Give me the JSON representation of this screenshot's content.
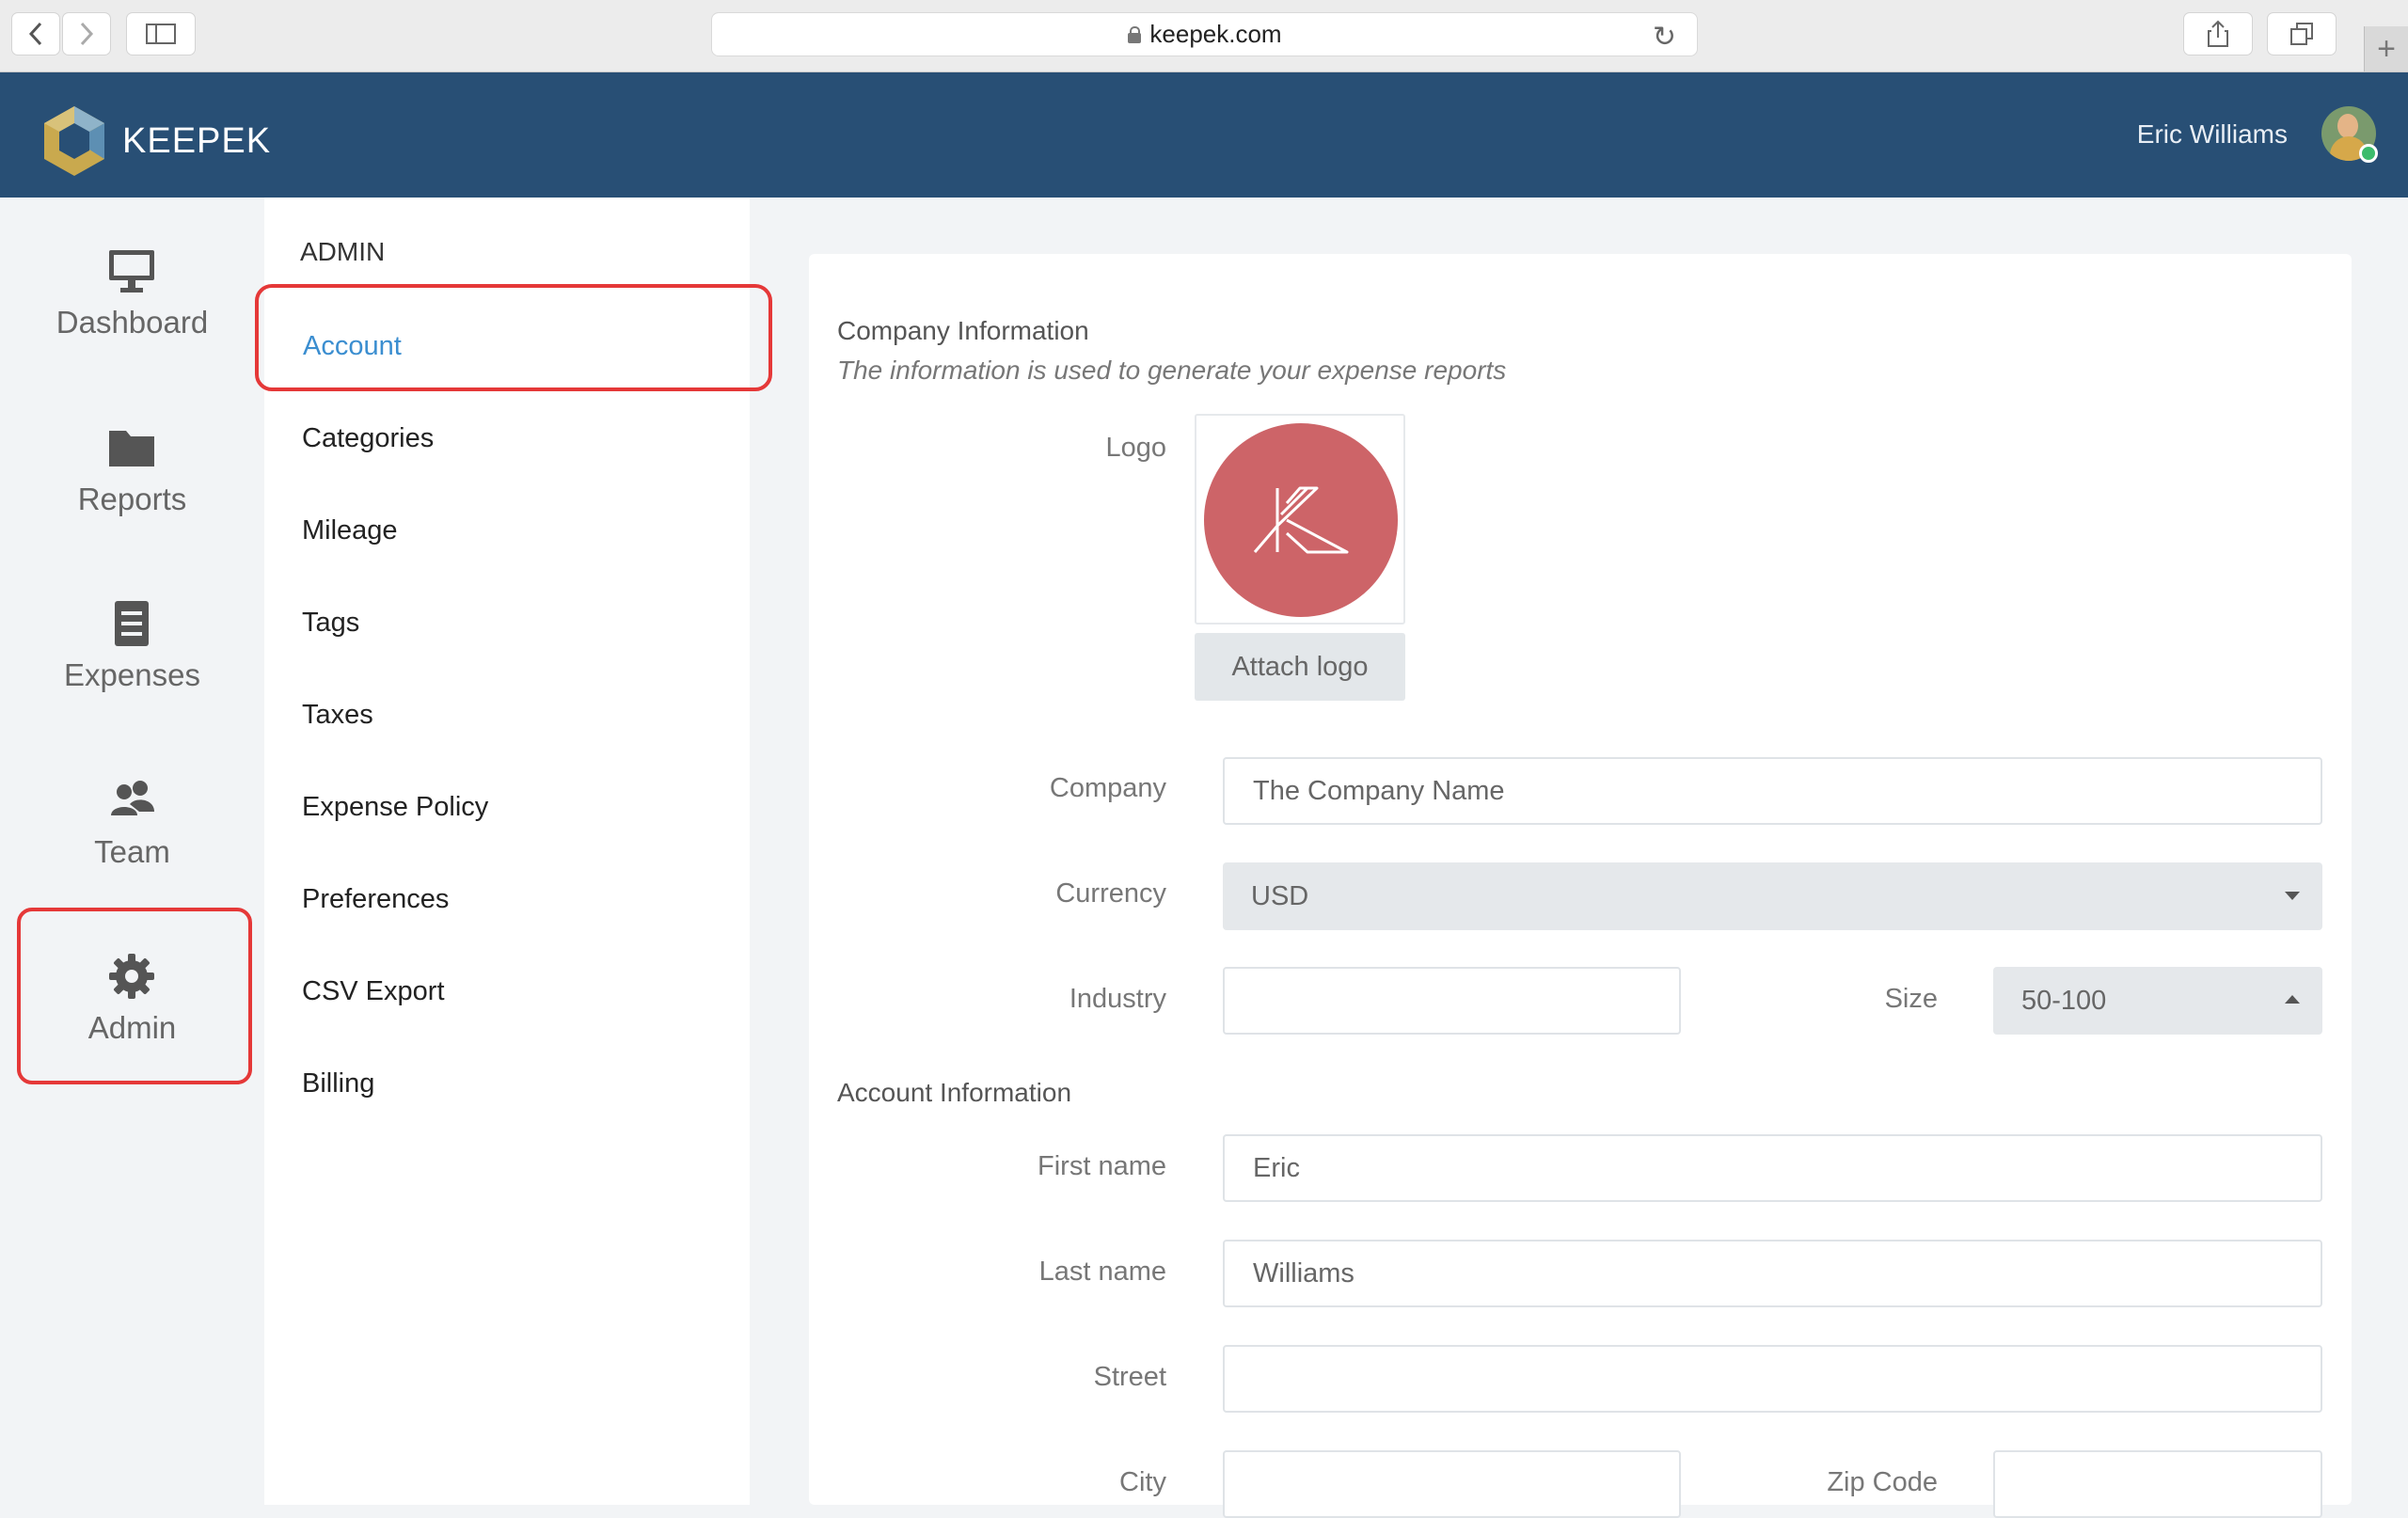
{
  "browser": {
    "url": "keepek.com"
  },
  "header": {
    "brand": "KEEPEK",
    "user_name": "Eric Williams"
  },
  "left_nav": {
    "items": [
      {
        "label": "Dashboard",
        "icon": "monitor-icon"
      },
      {
        "label": "Reports",
        "icon": "folder-icon"
      },
      {
        "label": "Expenses",
        "icon": "document-icon"
      },
      {
        "label": "Team",
        "icon": "users-icon"
      },
      {
        "label": "Admin",
        "icon": "gear-icon"
      }
    ]
  },
  "admin_menu": {
    "title": "ADMIN",
    "items": [
      {
        "label": "Account",
        "active": true
      },
      {
        "label": "Categories"
      },
      {
        "label": "Mileage"
      },
      {
        "label": "Tags"
      },
      {
        "label": "Taxes"
      },
      {
        "label": "Expense Policy"
      },
      {
        "label": "Preferences"
      },
      {
        "label": "CSV Export"
      },
      {
        "label": "Billing"
      }
    ]
  },
  "company": {
    "title": "Company Information",
    "subtitle": "The information is used to generate your expense reports",
    "logo_label": "Logo",
    "attach_logo": "Attach logo",
    "company_label": "Company",
    "company_placeholder": "The Company Name",
    "currency_label": "Currency",
    "currency_value": "USD",
    "industry_label": "Industry",
    "industry_value": "",
    "size_label": "Size",
    "size_value": "50-100"
  },
  "account": {
    "title": "Account Information",
    "first_name_label": "First name",
    "first_name_value": "Eric",
    "last_name_label": "Last name",
    "last_name_value": "Williams",
    "street_label": "Street",
    "street_value": "",
    "city_label": "City",
    "city_value": "",
    "zip_label": "Zip Code",
    "zip_value": ""
  },
  "colors": {
    "header_bg": "#284f75",
    "accent": "#3b8ed0",
    "highlight": "#e53838",
    "logo_circle": "#cd6468"
  }
}
